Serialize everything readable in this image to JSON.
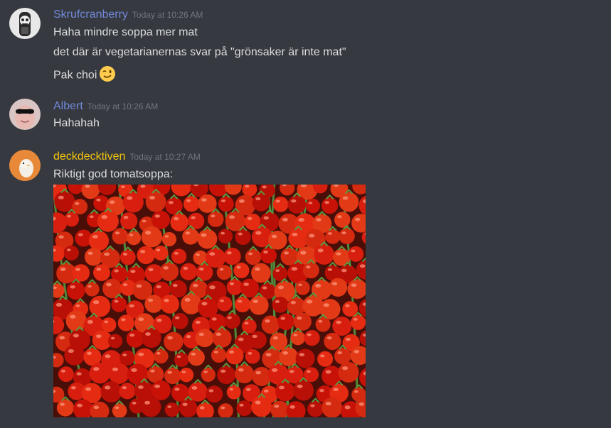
{
  "messages": [
    {
      "username": "Skrufcranberry",
      "username_color": "#7289da",
      "timestamp": "Today at 10:26 AM",
      "lines": [
        "Haha mindre soppa mer mat",
        "det där är vegetarianernas svar på \"grönsaker är inte mat\"",
        "Pak choi"
      ],
      "emoji": "winking-face"
    },
    {
      "username": "Albert",
      "username_color": "#7289da",
      "timestamp": "Today at 10:26 AM",
      "lines": [
        "Hahahah"
      ]
    },
    {
      "username": "deckdecktiven",
      "username_color": "#f1c40f",
      "timestamp": "Today at 10:27 AM",
      "lines": [
        "Riktigt god tomatsoppa:"
      ],
      "attachment": "photo of cherry tomatoes on the vine"
    }
  ]
}
